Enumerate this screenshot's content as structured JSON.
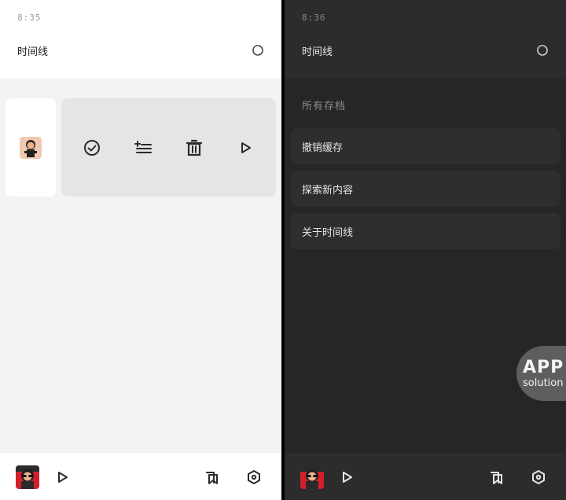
{
  "screens": {
    "light": {
      "time": "8:35",
      "title": "时间线",
      "icons": {
        "refresh": "refresh-icon",
        "check": "check-circle-icon",
        "add_list": "add-to-list-icon",
        "delete": "trash-icon",
        "play": "play-icon",
        "bookmark": "bookmark-stack-icon",
        "settings": "settings-hexagon-icon"
      }
    },
    "dark": {
      "time": "8:36",
      "title": "时间线",
      "section_label": "所有存档",
      "menu": [
        {
          "label": "撤销缓存"
        },
        {
          "label": "探索新内容"
        },
        {
          "label": "关于时间线"
        }
      ]
    },
    "watermark": {
      "line1": "APP",
      "line2": "solution"
    }
  },
  "colors": {
    "light_bg": "#f2f3f5",
    "light_panel": "#e4e5e7",
    "dark_bg": "#262626",
    "dark_card": "#2e2e2e",
    "icon_dark": "#2a2a2a",
    "icon_light": "#e6e6e6"
  }
}
